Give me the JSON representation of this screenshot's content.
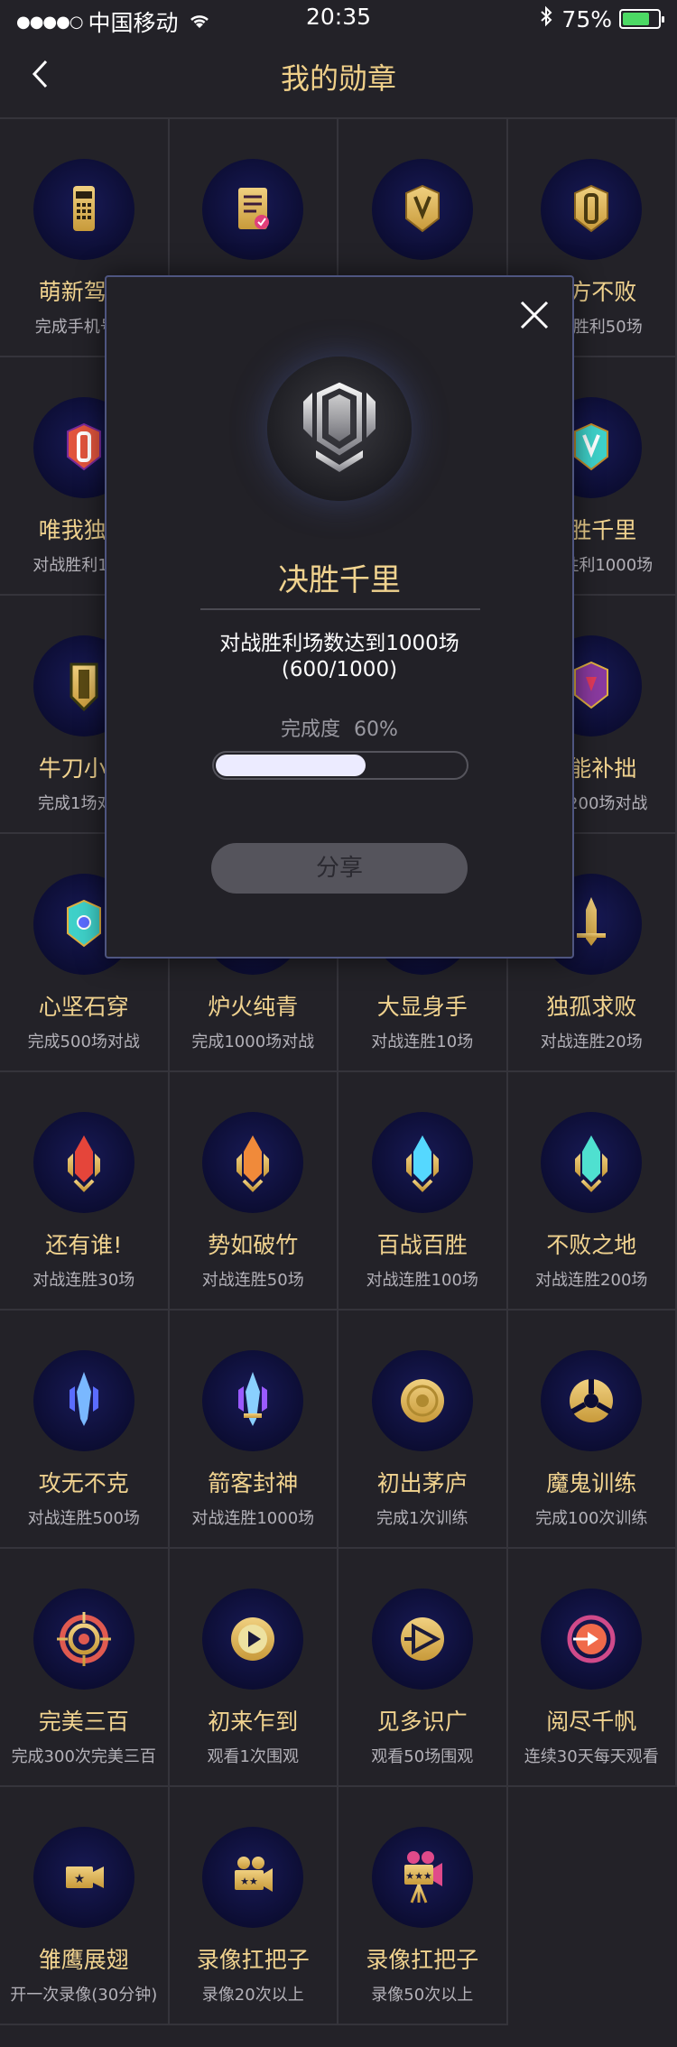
{
  "status_bar": {
    "signal": "●●●●○",
    "carrier": "中国移动",
    "time": "20:35",
    "battery_percent": "75%",
    "battery_level": 0.75,
    "battery_color": "#4cd964"
  },
  "nav": {
    "title": "我的勋章"
  },
  "badges": [
    {
      "name": "萌新驾到",
      "desc": "完成手机号…",
      "icon": "phone-badge-icon"
    },
    {
      "name": "",
      "desc": "",
      "icon": "scroll-badge-icon"
    },
    {
      "name": "",
      "desc": "",
      "icon": "shield-v-badge-icon"
    },
    {
      "name": "万方不败",
      "desc": "对战胜利50场",
      "icon": "shield-gold-badge-icon"
    },
    {
      "name": "唯我独尊",
      "desc": "对战胜利10…",
      "icon": "shield-fire-badge-icon"
    },
    {
      "name": "",
      "desc": "",
      "icon": ""
    },
    {
      "name": "",
      "desc": "",
      "icon": ""
    },
    {
      "name": "决胜千里",
      "desc": "对战胜利1000场",
      "icon": "shield-cyan-badge-icon"
    },
    {
      "name": "牛刀小试",
      "desc": "完成1场对…",
      "icon": "shield-plain-badge-icon"
    },
    {
      "name": "",
      "desc": "",
      "icon": ""
    },
    {
      "name": "",
      "desc": "",
      "icon": ""
    },
    {
      "name": "熟能补拙",
      "desc": "完成200场对战",
      "icon": "shield-gem-badge-icon"
    },
    {
      "name": "心坚石穿",
      "desc": "完成500场对战",
      "icon": "shield-cyan-gem-badge-icon"
    },
    {
      "name": "炉火纯青",
      "desc": "完成1000场对战",
      "icon": "shield-blue-badge-icon"
    },
    {
      "name": "大显身手",
      "desc": "对战连胜10场",
      "icon": "sword-blue-badge-icon"
    },
    {
      "name": "独孤求败",
      "desc": "对战连胜20场",
      "icon": "sword-gold-badge-icon"
    },
    {
      "name": "还有谁!",
      "desc": "对战连胜30场",
      "icon": "rocket-red-badge-icon"
    },
    {
      "name": "势如破竹",
      "desc": "对战连胜50场",
      "icon": "rocket-orange-badge-icon"
    },
    {
      "name": "百战百胜",
      "desc": "对战连胜100场",
      "icon": "rocket-cyan-badge-icon"
    },
    {
      "name": "不败之地",
      "desc": "对战连胜200场",
      "icon": "rocket-teal-badge-icon"
    },
    {
      "name": "攻无不克",
      "desc": "对战连胜500场",
      "icon": "blade-blue-badge-icon"
    },
    {
      "name": "箭客封神",
      "desc": "对战连胜1000场",
      "icon": "blade-purple-badge-icon"
    },
    {
      "name": "初出茅庐",
      "desc": "完成1次训练",
      "icon": "target-gold-badge-icon"
    },
    {
      "name": "魔鬼训练",
      "desc": "完成100次训练",
      "icon": "wheel-gold-badge-icon"
    },
    {
      "name": "完美三百",
      "desc": "完成300次完美三百",
      "icon": "target-red-badge-icon"
    },
    {
      "name": "初来乍到",
      "desc": "观看1次围观",
      "icon": "play-gold-badge-icon"
    },
    {
      "name": "见多识广",
      "desc": "观看50场围观",
      "icon": "play-outline-badge-icon"
    },
    {
      "name": "阅尽千帆",
      "desc": "连续30天每天观看",
      "icon": "play-red-badge-icon"
    },
    {
      "name": "雏鹰展翅",
      "desc": "开一次录像(30分钟)",
      "icon": "camera-star-badge-icon"
    },
    {
      "name": "录像扛把子",
      "desc": "录像20次以上",
      "icon": "camera-reel-badge-icon"
    },
    {
      "name": "录像扛把子",
      "desc": "录像50次以上",
      "icon": "camera-tripod-badge-icon"
    },
    {
      "name": "",
      "desc": "",
      "icon": ""
    }
  ],
  "modal": {
    "badge_icon": "shield-silver-badge-icon",
    "title": "决胜千里",
    "description": "对战胜利场数达到1000场",
    "progress_text": "(600/1000)",
    "rate_label": "完成度",
    "rate_value": "60%",
    "progress": 0.6,
    "share_label": "分享",
    "close_icon": "close-icon"
  }
}
